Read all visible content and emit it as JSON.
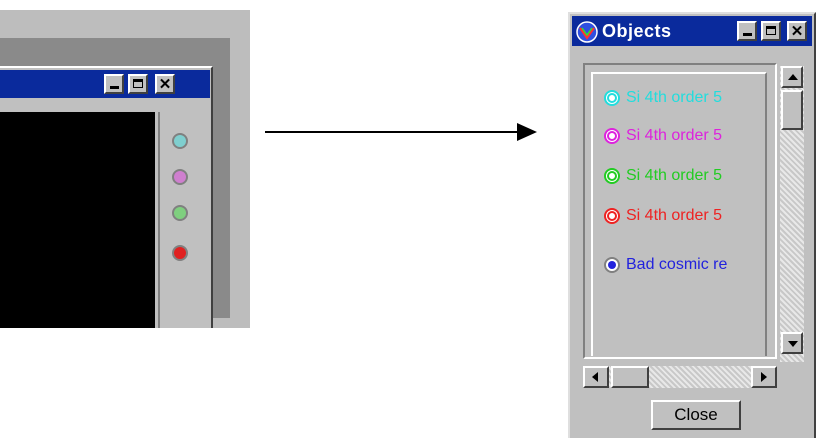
{
  "objects_window": {
    "title": "Objects",
    "items": [
      {
        "label": "Si 4th order 5",
        "color": "#22dddd",
        "selected": false
      },
      {
        "label": "Si 4th order 5",
        "color": "#dd22dd",
        "selected": false
      },
      {
        "label": "Si 4th order 5",
        "color": "#22cc22",
        "selected": false
      },
      {
        "label": "Si 4th order 5",
        "color": "#ee2222",
        "selected": false
      },
      {
        "label": "Bad cosmic re",
        "color": "#2222dd",
        "selected": true
      }
    ],
    "close_label": "Close"
  },
  "left_window": {
    "side_dots": [
      "#7fcfcf",
      "#cf7fcf",
      "#7fcf7f",
      "#e02020"
    ]
  },
  "colors": {
    "titlebar": "#0a2a9c",
    "window_face": "#c0c0c0"
  }
}
